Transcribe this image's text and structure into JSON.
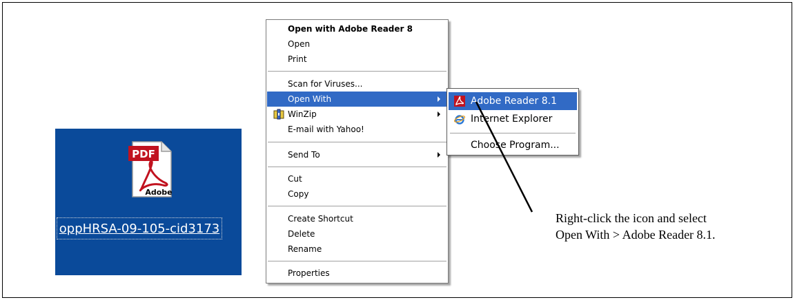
{
  "desktop": {
    "file_name": "oppHRSA-09-105-cid3173",
    "icon_badge": "PDF",
    "icon_brand": "Adobe",
    "icon": "pdf-file-icon",
    "background_color": "#0a4a9a"
  },
  "context_menu": {
    "items": [
      {
        "label": "Open with Adobe Reader 8"
      },
      {
        "label": "Open"
      },
      {
        "label": "Print"
      },
      {
        "label": "Scan for Viruses..."
      },
      {
        "label": "Open With",
        "submenu": true,
        "selected": true
      },
      {
        "label": "WinZip",
        "submenu": true,
        "icon": "winzip-icon"
      },
      {
        "label": "E-mail with Yahoo!"
      },
      {
        "label": "Send To",
        "submenu": true
      },
      {
        "label": "Cut"
      },
      {
        "label": "Copy"
      },
      {
        "label": "Create Shortcut"
      },
      {
        "label": "Delete"
      },
      {
        "label": "Rename"
      },
      {
        "label": "Properties"
      }
    ],
    "highlight_color": "#316ac5"
  },
  "submenu": {
    "items": [
      {
        "label": "Adobe Reader 8.1",
        "icon": "adobe-reader-icon",
        "selected": true
      },
      {
        "label": "Internet Explorer",
        "icon": "internet-explorer-icon"
      },
      {
        "label": "Choose Program..."
      }
    ]
  },
  "annotation": {
    "text": "Right-click the icon and select Open With > Adobe Reader 8.1."
  }
}
